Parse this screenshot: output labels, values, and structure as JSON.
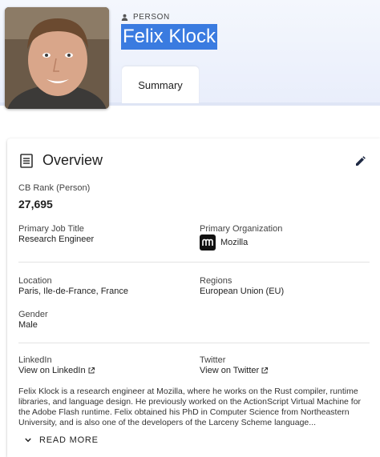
{
  "header": {
    "entity_type": "PERSON",
    "name": "Felix Klock",
    "tab_label": "Summary"
  },
  "overview": {
    "title": "Overview",
    "rank_label": "CB Rank (Person)",
    "rank_value": "27,695",
    "job_title_label": "Primary Job Title",
    "job_title_value": "Research Engineer",
    "org_label": "Primary Organization",
    "org_name": "Mozilla",
    "org_logo_icon": "mozilla-m-logo",
    "location_label": "Location",
    "location_value": "Paris, Ile-de-France, France",
    "regions_label": "Regions",
    "regions_value": "European Union (EU)",
    "gender_label": "Gender",
    "gender_value": "Male",
    "linkedin_label": "LinkedIn",
    "linkedin_link": "View on LinkedIn",
    "twitter_label": "Twitter",
    "twitter_link": "View on Twitter",
    "description": "Felix Klock is a research engineer at Mozilla, where he works on the Rust compiler, runtime libraries, and language design. He previously worked on the ActionScript Virtual Machine for the Adobe Flash runtime. Felix obtained his PhD in Computer Science from Northeastern University, and is also one of the developers of the Larceny Scheme language...",
    "read_more_label": "READ MORE"
  },
  "colors": {
    "name_highlight": "#3a7be0",
    "hero_background": "#e9eefb"
  }
}
